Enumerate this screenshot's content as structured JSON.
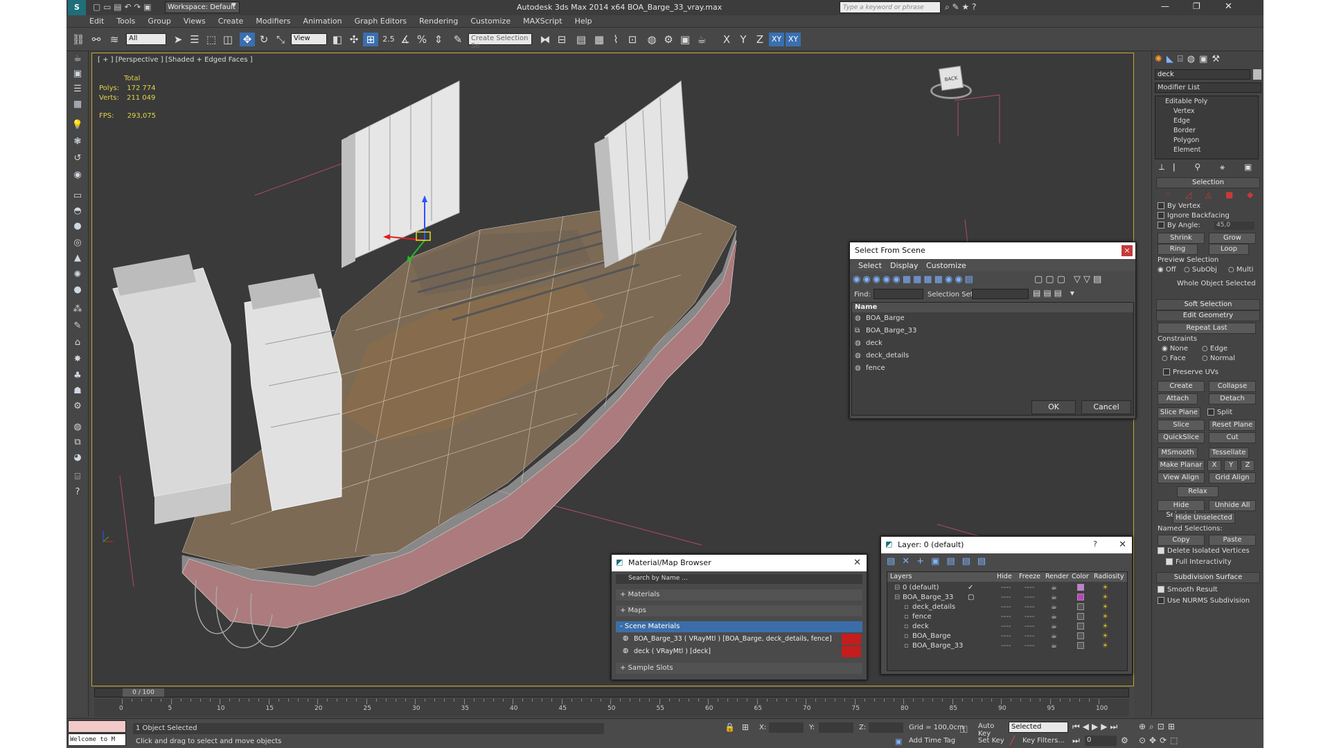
{
  "titlebar": {
    "workspace_label": "Workspace: Default",
    "title": "Autodesk 3ds Max  2014 x64    BOA_Barge_33_vray.max",
    "search_placeholder": "Type a keyword or phrase"
  },
  "menu": [
    "Edit",
    "Tools",
    "Group",
    "Views",
    "Create",
    "Modifiers",
    "Animation",
    "Graph Editors",
    "Rendering",
    "Customize",
    "MAXScript",
    "Help"
  ],
  "toolbar": {
    "filter_value": "All",
    "refcoord_value": "View",
    "spinner_snap": "2.5",
    "named_selection_placeholder": "Create Selection Se",
    "axis_labels": [
      "X",
      "Y",
      "Z",
      "XY",
      "XY"
    ]
  },
  "viewport": {
    "label": "[ + ] [Perspective ] [Shaded + Edged Faces ]",
    "stats_total": "Total",
    "polys_label": "Polys:",
    "polys_value": "172 774",
    "verts_label": "Verts:",
    "verts_value": "211 049",
    "fps_label": "FPS:",
    "fps_value": "293,075",
    "viewcube_label": "BACK"
  },
  "select_from_scene": {
    "title": "Select From Scene",
    "tabs": [
      "Select",
      "Display",
      "Customize"
    ],
    "find_label": "Find:",
    "selection_set_label": "Selection Set:",
    "column_name": "Name",
    "items": [
      "BOA_Barge",
      "BOA_Barge_33",
      "deck",
      "deck_details",
      "fence"
    ],
    "ok": "OK",
    "cancel": "Cancel"
  },
  "material_browser": {
    "title": "Material/Map Browser",
    "search_placeholder": "Search by Name ...",
    "sections": [
      "+ Materials",
      "+ Maps",
      "- Scene Materials"
    ],
    "scene_materials": [
      "BOA_Barge_33  ( VRayMtl )  [BOA_Barge, deck_details, fence]",
      "deck  ( VRayMtl )  [deck]"
    ],
    "sample_slots": "+ Sample Slots"
  },
  "layers": {
    "title": "Layer: 0 (default)",
    "help": "?",
    "columns": [
      "Layers",
      "Hide",
      "Freeze",
      "Render",
      "Color",
      "Radiosity"
    ],
    "rows": [
      {
        "name": "0 (default)",
        "indent": 0,
        "color": "#c77ad6"
      },
      {
        "name": "BOA_Barge_33",
        "indent": 0,
        "color": "#c23fc2"
      },
      {
        "name": "deck_details",
        "indent": 1,
        "color": "#555555"
      },
      {
        "name": "fence",
        "indent": 1,
        "color": "#555555"
      },
      {
        "name": "deck",
        "indent": 1,
        "color": "#555555"
      },
      {
        "name": "BOA_Barge",
        "indent": 1,
        "color": "#555555"
      },
      {
        "name": "BOA_Barge_33",
        "indent": 1,
        "color": "#555555"
      }
    ],
    "dash": "----"
  },
  "command_panel": {
    "object_name": "deck",
    "modifier_list": "Modifier List",
    "stack": [
      "Editable Poly",
      "Vertex",
      "Edge",
      "Border",
      "Polygon",
      "Element"
    ],
    "selection_header": "Selection",
    "by_vertex": "By Vertex",
    "ignore_backfacing": "Ignore Backfacing",
    "by_angle": "By Angle:",
    "by_angle_value": "45,0",
    "shrink": "Shrink",
    "grow": "Grow",
    "ring": "Ring",
    "loop": "Loop",
    "preview_selection": "Preview Selection",
    "preview_options": [
      "Off",
      "SubObj",
      "Multi"
    ],
    "whole_object": "Whole Object Selected",
    "soft_selection": "Soft Selection",
    "edit_geometry": "Edit Geometry",
    "repeat_last": "Repeat Last",
    "constraints": "Constraints",
    "constraint_options": [
      "None",
      "Edge",
      "Face",
      "Normal"
    ],
    "preserve_uvs": "Preserve UVs",
    "create": "Create",
    "collapse": "Collapse",
    "attach": "Attach",
    "detach": "Detach",
    "slice_plane": "Slice Plane",
    "split": "Split",
    "slice": "Slice",
    "reset_plane": "Reset Plane",
    "quickslice": "QuickSlice",
    "cut": "Cut",
    "msmooth": "MSmooth",
    "tessellate": "Tessellate",
    "make_planar": "Make Planar",
    "xyz": [
      "X",
      "Y",
      "Z"
    ],
    "view_align": "View Align",
    "grid_align": "Grid Align",
    "relax": "Relax",
    "hide_selected": "Hide Selected",
    "unhide_all": "Unhide All",
    "hide_unselected": "Hide Unselected",
    "named_selections": "Named Selections:",
    "copy": "Copy",
    "paste": "Paste",
    "delete_isolated": "Delete Isolated Vertices",
    "full_interactivity": "Full Interactivity",
    "subdivision_surface": "Subdivision Surface",
    "smooth_result": "Smooth Result",
    "use_nurms": "Use NURMS Subdivision"
  },
  "timeline": {
    "frame": "0 / 100",
    "ticks": [
      "0",
      "5",
      "10",
      "15",
      "20",
      "25",
      "30",
      "35",
      "40",
      "45",
      "50",
      "55",
      "60",
      "65",
      "70",
      "75",
      "80",
      "85",
      "90",
      "95",
      "100"
    ]
  },
  "status": {
    "listener": "Welcome to M",
    "selected": "1 Object Selected",
    "prompt": "Click and drag to select and move objects",
    "x_label": "X:",
    "y_label": "Y:",
    "z_label": "Z:",
    "grid": "Grid = 100,0cm",
    "add_time_tag": "Add Time Tag",
    "auto_key": "Auto Key",
    "set_key": "Set Key",
    "key_mode_value": "Selected",
    "key_filters": "Key Filters...",
    "frame_value": "0"
  }
}
